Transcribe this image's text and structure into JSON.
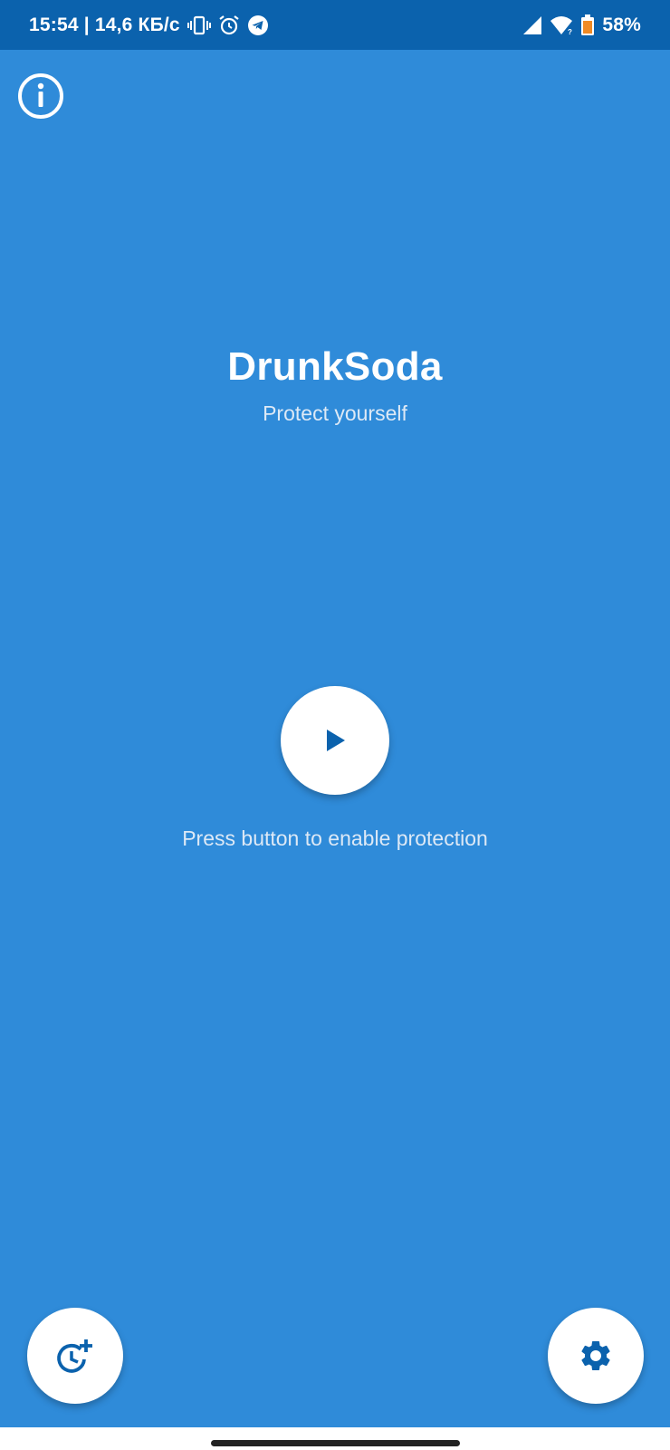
{
  "status_bar": {
    "time_and_speed": "15:54 | 14,6 КБ/с",
    "battery_percent": "58%",
    "icons": [
      "vibrate-icon",
      "alarm-icon",
      "telegram-icon",
      "signal-icon",
      "wifi-icon",
      "battery-icon"
    ]
  },
  "app": {
    "title": "DrunkSoda",
    "subtitle": "Protect yourself",
    "hint": "Press button to enable protection"
  },
  "colors": {
    "status_bar": "#0b62ad",
    "background": "#2f8bd9",
    "accent": "#0b62ad",
    "fab_background": "#ffffff"
  },
  "icons": {
    "info": "info-icon",
    "play": "play-icon",
    "schedule": "schedule-add-icon",
    "settings": "gear-icon"
  }
}
